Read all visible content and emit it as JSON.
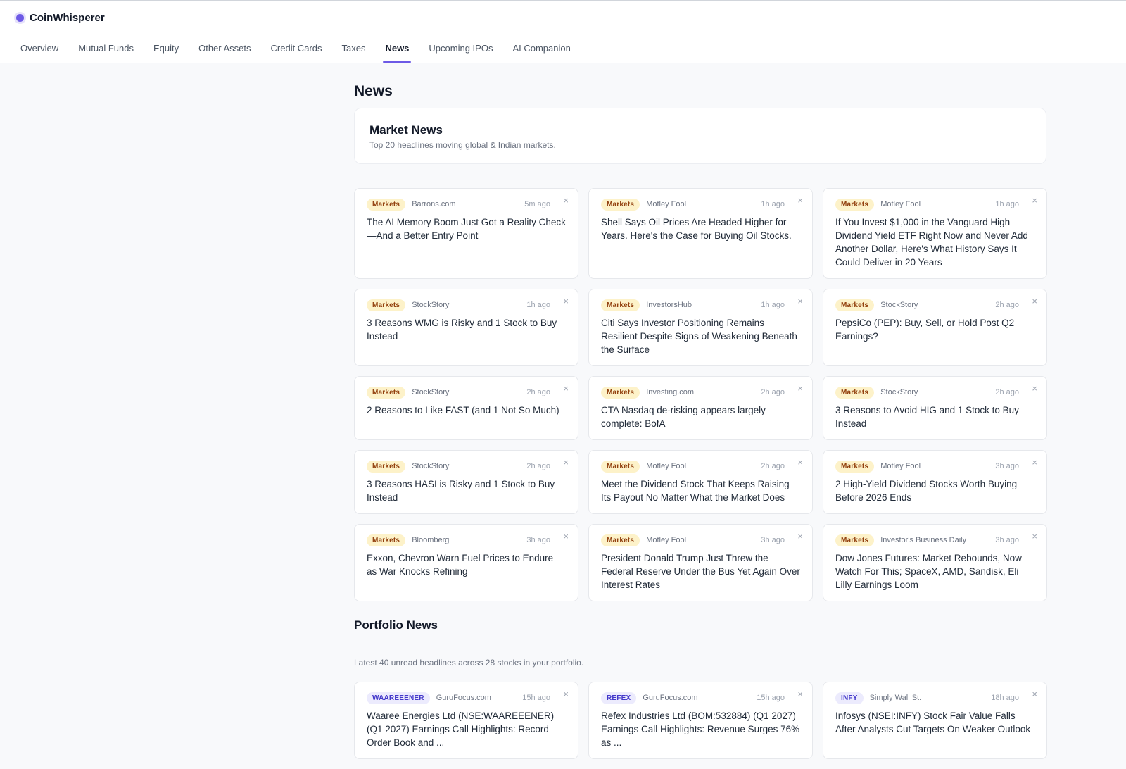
{
  "app": {
    "name": "CoinWhisperer"
  },
  "tabs": [
    {
      "label": "Overview"
    },
    {
      "label": "Mutual Funds"
    },
    {
      "label": "Equity"
    },
    {
      "label": "Other Assets"
    },
    {
      "label": "Credit Cards"
    },
    {
      "label": "Taxes"
    },
    {
      "label": "News"
    },
    {
      "label": "Upcoming IPOs"
    },
    {
      "label": "AI Companion"
    }
  ],
  "page": {
    "title": "News"
  },
  "market": {
    "title": "Market News",
    "subtitle": "Top 20 headlines moving global & Indian markets.",
    "items": [
      {
        "tag": "Markets",
        "source": "Barrons.com",
        "time": "5m ago",
        "headline": "The AI Memory Boom Just Got a Reality Check—And a Better Entry Point"
      },
      {
        "tag": "Markets",
        "source": "Motley Fool",
        "time": "1h ago",
        "headline": "Shell Says Oil Prices Are Headed Higher for Years. Here's the Case for Buying Oil Stocks."
      },
      {
        "tag": "Markets",
        "source": "Motley Fool",
        "time": "1h ago",
        "headline": "If You Invest $1,000 in the Vanguard High Dividend Yield ETF Right Now and Never Add Another Dollar, Here's What History Says It Could Deliver in 20 Years"
      },
      {
        "tag": "Markets",
        "source": "StockStory",
        "time": "1h ago",
        "headline": "3 Reasons WMG is Risky and 1 Stock to Buy Instead"
      },
      {
        "tag": "Markets",
        "source": "InvestorsHub",
        "time": "1h ago",
        "headline": "Citi Says Investor Positioning Remains Resilient Despite Signs of Weakening Beneath the Surface"
      },
      {
        "tag": "Markets",
        "source": "StockStory",
        "time": "2h ago",
        "headline": "PepsiCo (PEP): Buy, Sell, or Hold Post Q2 Earnings?"
      },
      {
        "tag": "Markets",
        "source": "StockStory",
        "time": "2h ago",
        "headline": "2 Reasons to Like FAST (and 1 Not So Much)"
      },
      {
        "tag": "Markets",
        "source": "Investing.com",
        "time": "2h ago",
        "headline": "CTA Nasdaq de-risking appears largely complete: BofA"
      },
      {
        "tag": "Markets",
        "source": "StockStory",
        "time": "2h ago",
        "headline": "3 Reasons to Avoid HIG and 1 Stock to Buy Instead"
      },
      {
        "tag": "Markets",
        "source": "StockStory",
        "time": "2h ago",
        "headline": "3 Reasons HASI is Risky and 1 Stock to Buy Instead"
      },
      {
        "tag": "Markets",
        "source": "Motley Fool",
        "time": "2h ago",
        "headline": "Meet the Dividend Stock That Keeps Raising Its Payout No Matter What the Market Does"
      },
      {
        "tag": "Markets",
        "source": "Motley Fool",
        "time": "3h ago",
        "headline": "2 High-Yield Dividend Stocks Worth Buying Before 2026 Ends"
      },
      {
        "tag": "Markets",
        "source": "Bloomberg",
        "time": "3h ago",
        "headline": "Exxon, Chevron Warn Fuel Prices to Endure as War Knocks Refining"
      },
      {
        "tag": "Markets",
        "source": "Motley Fool",
        "time": "3h ago",
        "headline": "President Donald Trump Just Threw the Federal Reserve Under the Bus Yet Again Over Interest Rates"
      },
      {
        "tag": "Markets",
        "source": "Investor's Business Daily",
        "time": "3h ago",
        "headline": "Dow Jones Futures: Market Rebounds, Now Watch For This; SpaceX, AMD, Sandisk, Eli Lilly Earnings Loom"
      }
    ]
  },
  "portfolio": {
    "title": "Portfolio News",
    "subtitle": "Latest 40 unread headlines across 28 stocks in your portfolio.",
    "items": [
      {
        "tag": "WAAREEENER",
        "source": "GuruFocus.com",
        "time": "15h ago",
        "headline": "Waaree Energies Ltd (NSE:WAAREEENER) (Q1 2027) Earnings Call Highlights: Record Order Book and ..."
      },
      {
        "tag": "REFEX",
        "source": "GuruFocus.com",
        "time": "15h ago",
        "headline": "Refex Industries Ltd (BOM:532884) (Q1 2027) Earnings Call Highlights: Revenue Surges 76% as ..."
      },
      {
        "tag": "INFY",
        "source": "Simply Wall St.",
        "time": "18h ago",
        "headline": "Infosys (NSEI:INFY) Stock Fair Value Falls After Analysts Cut Targets On Weaker Outlook"
      }
    ]
  },
  "icons": {
    "close": "close-icon",
    "close_glyph": "×"
  }
}
